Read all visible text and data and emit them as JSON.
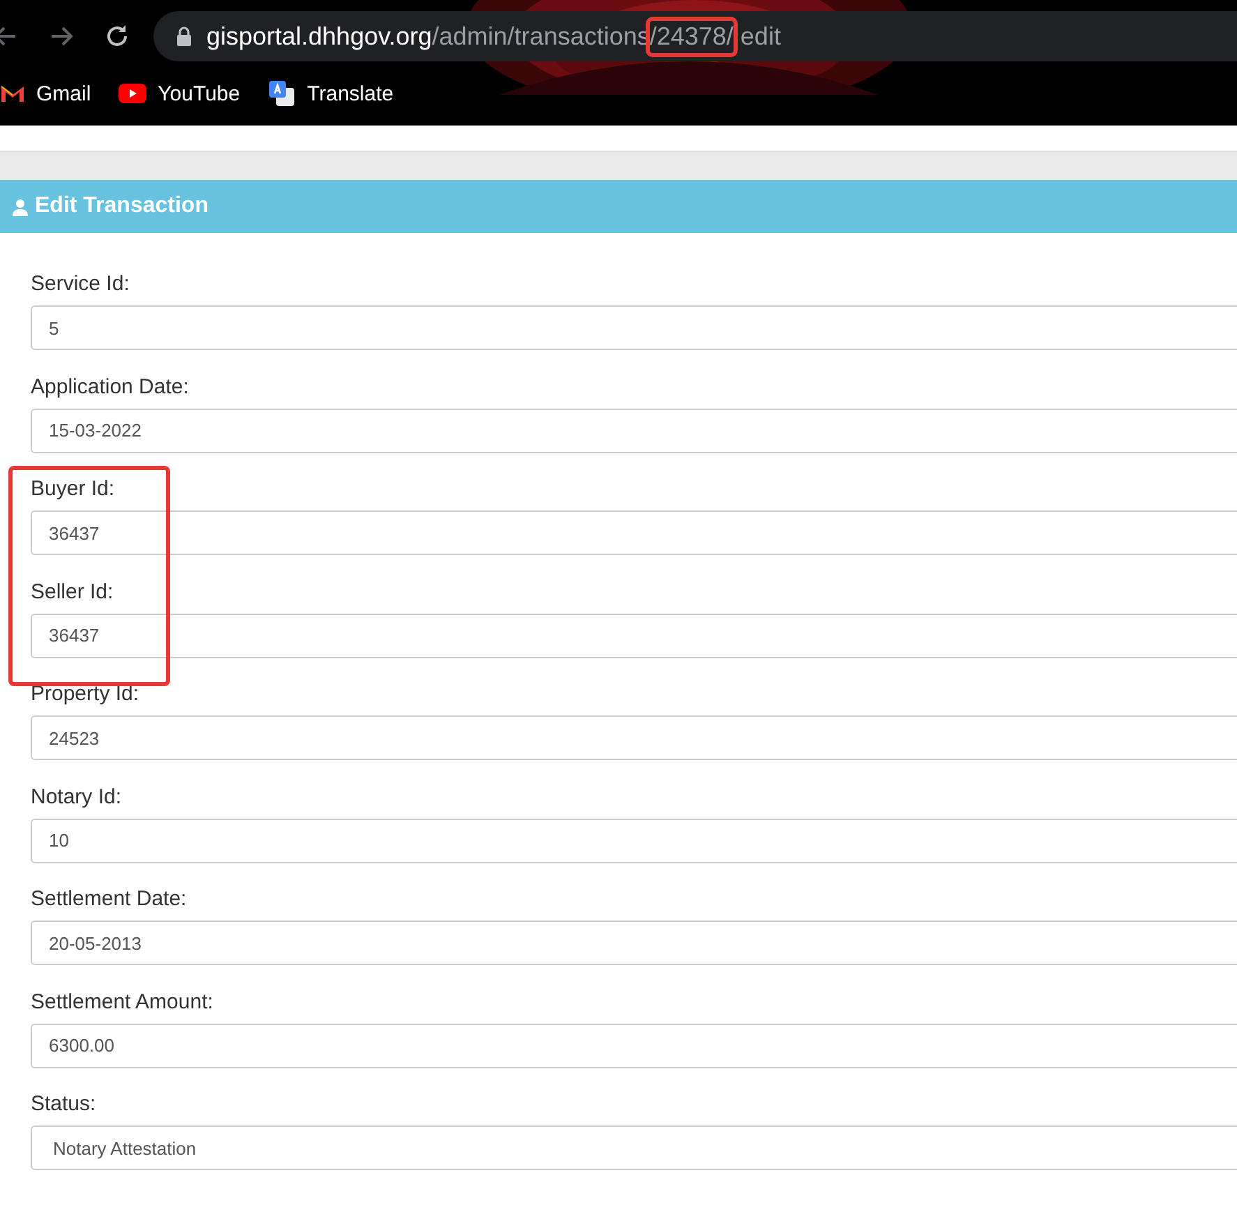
{
  "browser": {
    "url": [
      {
        "text": "gisportal.dhhgov.org",
        "kind": "host",
        "highlighted": false
      },
      {
        "text": "/admin/transactions",
        "kind": "path",
        "highlighted": false
      },
      {
        "text": "/24378/",
        "kind": "path",
        "highlighted": true
      },
      {
        "text": "edit",
        "kind": "path",
        "highlighted": false
      }
    ],
    "bookmarks": [
      {
        "label": "Gmail",
        "kind": "gmail"
      },
      {
        "label": "YouTube",
        "kind": "youtube"
      },
      {
        "label": "Translate",
        "kind": "translate"
      }
    ]
  },
  "panel": {
    "title": "Edit Transaction"
  },
  "fields": [
    {
      "label": "Service Id:",
      "value": "5",
      "kind": "text",
      "highlighted": false
    },
    {
      "label": "Application Date:",
      "value": "15-03-2022",
      "kind": "text",
      "highlighted": false
    },
    {
      "label": "Buyer Id:",
      "value": "36437",
      "kind": "text",
      "highlighted": true
    },
    {
      "label": "Seller Id:",
      "value": "36437",
      "kind": "text",
      "highlighted": true
    },
    {
      "label": "Property Id:",
      "value": "24523",
      "kind": "text",
      "highlighted": false
    },
    {
      "label": "Notary Id:",
      "value": "10",
      "kind": "text",
      "highlighted": false
    },
    {
      "label": "Settlement Date:",
      "value": "20-05-2013",
      "kind": "text",
      "highlighted": false
    },
    {
      "label": "Settlement Amount:",
      "value": "6300.00",
      "kind": "text",
      "highlighted": false
    },
    {
      "label": "Status:",
      "value": "Notary Attestation",
      "kind": "select",
      "highlighted": false
    }
  ]
}
